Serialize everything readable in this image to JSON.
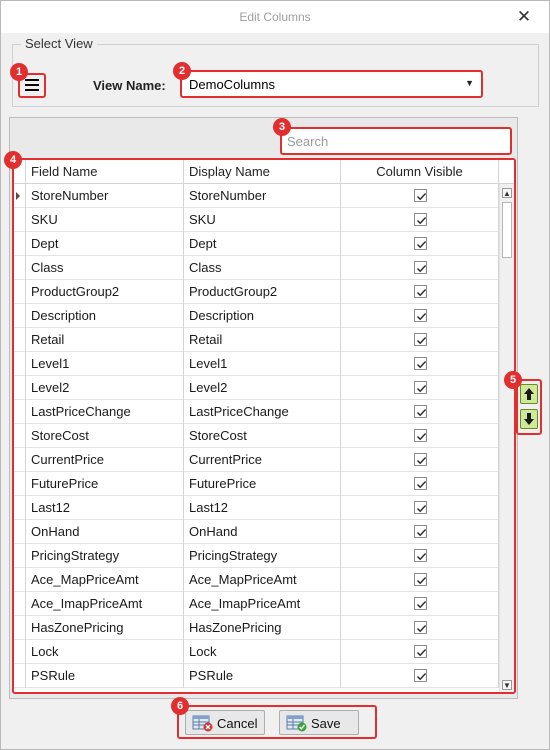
{
  "window": {
    "title": "Edit Columns"
  },
  "select_view": {
    "legend": "Select View",
    "view_name_label": "View Name:",
    "view_name_value": "DemoColumns"
  },
  "search": {
    "placeholder": "Search"
  },
  "grid": {
    "headers": {
      "field_name": "Field Name",
      "display_name": "Display Name",
      "column_visible": "Column Visible"
    },
    "rows": [
      {
        "field": "StoreNumber",
        "display": "StoreNumber",
        "visible": true
      },
      {
        "field": "SKU",
        "display": "SKU",
        "visible": true
      },
      {
        "field": "Dept",
        "display": "Dept",
        "visible": true
      },
      {
        "field": "Class",
        "display": "Class",
        "visible": true
      },
      {
        "field": "ProductGroup2",
        "display": "ProductGroup2",
        "visible": true
      },
      {
        "field": "Description",
        "display": "Description",
        "visible": true
      },
      {
        "field": "Retail",
        "display": "Retail",
        "visible": true
      },
      {
        "field": "Level1",
        "display": "Level1",
        "visible": true
      },
      {
        "field": "Level2",
        "display": "Level2",
        "visible": true
      },
      {
        "field": "LastPriceChange",
        "display": "LastPriceChange",
        "visible": true
      },
      {
        "field": "StoreCost",
        "display": "StoreCost",
        "visible": true
      },
      {
        "field": "CurrentPrice",
        "display": "CurrentPrice",
        "visible": true
      },
      {
        "field": "FuturePrice",
        "display": "FuturePrice",
        "visible": true
      },
      {
        "field": "Last12",
        "display": "Last12",
        "visible": true
      },
      {
        "field": "OnHand",
        "display": "OnHand",
        "visible": true
      },
      {
        "field": "PricingStrategy",
        "display": "PricingStrategy",
        "visible": true
      },
      {
        "field": "Ace_MapPriceAmt",
        "display": "Ace_MapPriceAmt",
        "visible": true
      },
      {
        "field": "Ace_ImapPriceAmt",
        "display": "Ace_ImapPriceAmt",
        "visible": true
      },
      {
        "field": "HasZonePricing",
        "display": "HasZonePricing",
        "visible": true
      },
      {
        "field": "Lock",
        "display": "Lock",
        "visible": true
      },
      {
        "field": "PSRule",
        "display": "PSRule",
        "visible": true
      }
    ]
  },
  "footer": {
    "cancel_label": "Cancel",
    "save_label": "Save"
  },
  "badges": [
    "1",
    "2",
    "3",
    "4",
    "5",
    "6"
  ],
  "colors": {
    "highlight": "#e12e2e",
    "arrow_green": "#cfe99a"
  },
  "icons": {
    "close": "close-icon",
    "menu": "hamburger-menu-icon",
    "dropdown": "chevron-down-icon",
    "move_up": "arrow-up-icon",
    "move_down": "arrow-down-icon",
    "cancel": "cancel-icon",
    "save": "save-icon"
  }
}
